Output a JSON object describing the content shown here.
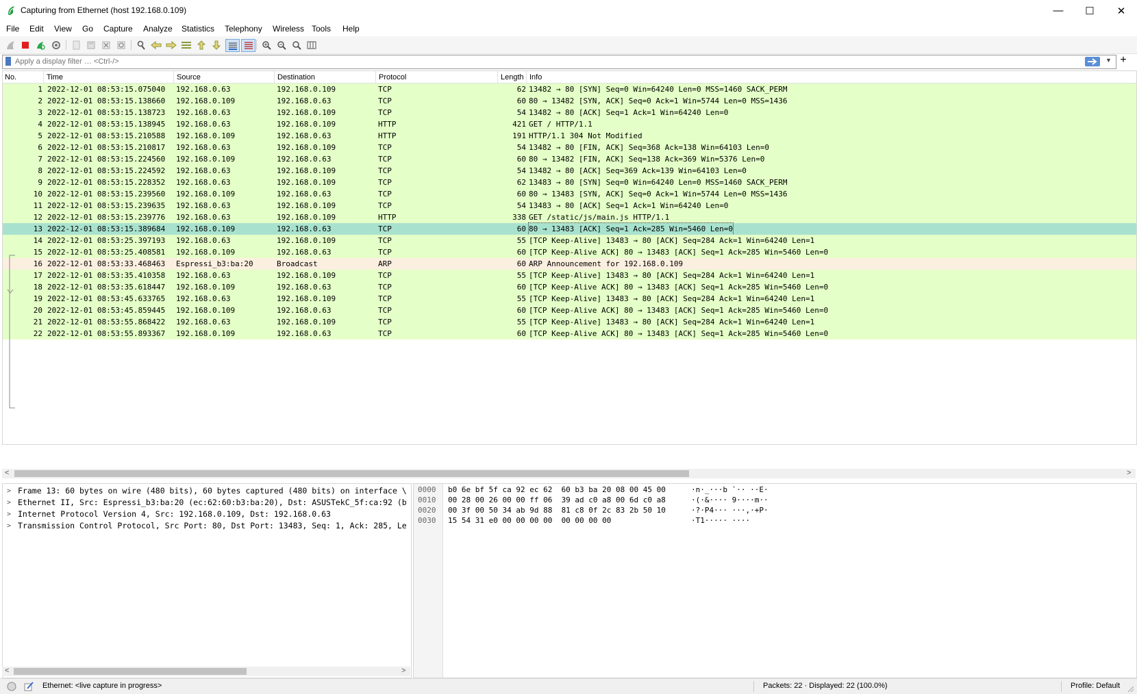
{
  "window": {
    "title": "Capturing from Ethernet (host 192.168.0.109)",
    "buttons": [
      "—",
      "☐",
      "✕"
    ]
  },
  "menu": [
    "File",
    "Edit",
    "View",
    "Go",
    "Capture",
    "Analyze",
    "Statistics",
    "Telephony",
    "Wireless",
    "Tools",
    "Help"
  ],
  "toolbar_icons": [
    "shark-fin-icon",
    "stop-icon",
    "restart-icon",
    "options-gear-icon",
    "open-file-icon",
    "save-file-icon",
    "close-file-icon",
    "reload-icon",
    "find-icon",
    "go-back-icon",
    "go-forward-icon",
    "go-to-packet-icon",
    "first-packet-icon",
    "last-packet-icon",
    "autoscroll-icon",
    "colorize-icon",
    "zoom-in-icon",
    "zoom-out-icon",
    "normal-size-icon",
    "resize-columns-icon"
  ],
  "filter": {
    "placeholder": "Apply a display filter … <Ctrl-/>",
    "value": ""
  },
  "columns": [
    "No.",
    "Time",
    "Source",
    "Destination",
    "Protocol",
    "Length",
    "Info"
  ],
  "colors": {
    "tcp": "#e4ffc7",
    "arp": "#fbefdf",
    "selected": "#a8e2cf"
  },
  "packets": [
    {
      "no": "1",
      "time": "2022-12-01 08:53:15.075040",
      "src": "192.168.0.63",
      "dst": "192.168.0.109",
      "proto": "TCP",
      "len": "62",
      "info": "13482 → 80 [SYN] Seq=0 Win=64240 Len=0 MSS=1460 SACK_PERM"
    },
    {
      "no": "2",
      "time": "2022-12-01 08:53:15.138660",
      "src": "192.168.0.109",
      "dst": "192.168.0.63",
      "proto": "TCP",
      "len": "60",
      "info": "80 → 13482 [SYN, ACK] Seq=0 Ack=1 Win=5744 Len=0 MSS=1436"
    },
    {
      "no": "3",
      "time": "2022-12-01 08:53:15.138723",
      "src": "192.168.0.63",
      "dst": "192.168.0.109",
      "proto": "TCP",
      "len": "54",
      "info": "13482 → 80 [ACK] Seq=1 Ack=1 Win=64240 Len=0"
    },
    {
      "no": "4",
      "time": "2022-12-01 08:53:15.138945",
      "src": "192.168.0.63",
      "dst": "192.168.0.109",
      "proto": "HTTP",
      "len": "421",
      "info": "GET / HTTP/1.1"
    },
    {
      "no": "5",
      "time": "2022-12-01 08:53:15.210588",
      "src": "192.168.0.109",
      "dst": "192.168.0.63",
      "proto": "HTTP",
      "len": "191",
      "info": "HTTP/1.1 304 Not Modified"
    },
    {
      "no": "6",
      "time": "2022-12-01 08:53:15.210817",
      "src": "192.168.0.63",
      "dst": "192.168.0.109",
      "proto": "TCP",
      "len": "54",
      "info": "13482 → 80 [FIN, ACK] Seq=368 Ack=138 Win=64103 Len=0"
    },
    {
      "no": "7",
      "time": "2022-12-01 08:53:15.224560",
      "src": "192.168.0.109",
      "dst": "192.168.0.63",
      "proto": "TCP",
      "len": "60",
      "info": "80 → 13482 [FIN, ACK] Seq=138 Ack=369 Win=5376 Len=0"
    },
    {
      "no": "8",
      "time": "2022-12-01 08:53:15.224592",
      "src": "192.168.0.63",
      "dst": "192.168.0.109",
      "proto": "TCP",
      "len": "54",
      "info": "13482 → 80 [ACK] Seq=369 Ack=139 Win=64103 Len=0"
    },
    {
      "no": "9",
      "time": "2022-12-01 08:53:15.228352",
      "src": "192.168.0.63",
      "dst": "192.168.0.109",
      "proto": "TCP",
      "len": "62",
      "info": "13483 → 80 [SYN] Seq=0 Win=64240 Len=0 MSS=1460 SACK_PERM"
    },
    {
      "no": "10",
      "time": "2022-12-01 08:53:15.239560",
      "src": "192.168.0.109",
      "dst": "192.168.0.63",
      "proto": "TCP",
      "len": "60",
      "info": "80 → 13483 [SYN, ACK] Seq=0 Ack=1 Win=5744 Len=0 MSS=1436"
    },
    {
      "no": "11",
      "time": "2022-12-01 08:53:15.239635",
      "src": "192.168.0.63",
      "dst": "192.168.0.109",
      "proto": "TCP",
      "len": "54",
      "info": "13483 → 80 [ACK] Seq=1 Ack=1 Win=64240 Len=0"
    },
    {
      "no": "12",
      "time": "2022-12-01 08:53:15.239776",
      "src": "192.168.0.63",
      "dst": "192.168.0.109",
      "proto": "HTTP",
      "len": "338",
      "info": "GET /static/js/main.js HTTP/1.1"
    },
    {
      "no": "13",
      "time": "2022-12-01 08:53:15.389684",
      "src": "192.168.0.109",
      "dst": "192.168.0.63",
      "proto": "TCP",
      "len": "60",
      "info": "80 → 13483 [ACK] Seq=1 Ack=285 Win=5460 Len=0",
      "selected": true
    },
    {
      "no": "14",
      "time": "2022-12-01 08:53:25.397193",
      "src": "192.168.0.63",
      "dst": "192.168.0.109",
      "proto": "TCP",
      "len": "55",
      "info": "[TCP Keep-Alive] 13483 → 80 [ACK] Seq=284 Ack=1 Win=64240 Len=1"
    },
    {
      "no": "15",
      "time": "2022-12-01 08:53:25.408581",
      "src": "192.168.0.109",
      "dst": "192.168.0.63",
      "proto": "TCP",
      "len": "60",
      "info": "[TCP Keep-Alive ACK] 80 → 13483 [ACK] Seq=1 Ack=285 Win=5460 Len=0"
    },
    {
      "no": "16",
      "time": "2022-12-01 08:53:33.468463",
      "src": "Espressi_b3:ba:20",
      "dst": "Broadcast",
      "proto": "ARP",
      "len": "60",
      "info": "ARP Announcement for 192.168.0.109"
    },
    {
      "no": "17",
      "time": "2022-12-01 08:53:35.410358",
      "src": "192.168.0.63",
      "dst": "192.168.0.109",
      "proto": "TCP",
      "len": "55",
      "info": "[TCP Keep-Alive] 13483 → 80 [ACK] Seq=284 Ack=1 Win=64240 Len=1"
    },
    {
      "no": "18",
      "time": "2022-12-01 08:53:35.618447",
      "src": "192.168.0.109",
      "dst": "192.168.0.63",
      "proto": "TCP",
      "len": "60",
      "info": "[TCP Keep-Alive ACK] 80 → 13483 [ACK] Seq=1 Ack=285 Win=5460 Len=0"
    },
    {
      "no": "19",
      "time": "2022-12-01 08:53:45.633765",
      "src": "192.168.0.63",
      "dst": "192.168.0.109",
      "proto": "TCP",
      "len": "55",
      "info": "[TCP Keep-Alive] 13483 → 80 [ACK] Seq=284 Ack=1 Win=64240 Len=1"
    },
    {
      "no": "20",
      "time": "2022-12-01 08:53:45.859445",
      "src": "192.168.0.109",
      "dst": "192.168.0.63",
      "proto": "TCP",
      "len": "60",
      "info": "[TCP Keep-Alive ACK] 80 → 13483 [ACK] Seq=1 Ack=285 Win=5460 Len=0"
    },
    {
      "no": "21",
      "time": "2022-12-01 08:53:55.868422",
      "src": "192.168.0.63",
      "dst": "192.168.0.109",
      "proto": "TCP",
      "len": "55",
      "info": "[TCP Keep-Alive] 13483 → 80 [ACK] Seq=284 Ack=1 Win=64240 Len=1"
    },
    {
      "no": "22",
      "time": "2022-12-01 08:53:55.893367",
      "src": "192.168.0.109",
      "dst": "192.168.0.63",
      "proto": "TCP",
      "len": "60",
      "info": "[TCP Keep-Alive ACK] 80 → 13483 [ACK] Seq=1 Ack=285 Win=5460 Len=0"
    }
  ],
  "details": [
    "Frame 13: 60 bytes on wire (480 bits), 60 bytes captured (480 bits) on interface \\",
    "Ethernet II, Src: Espressi_b3:ba:20 (ec:62:60:b3:ba:20), Dst: ASUSTekC_5f:ca:92 (b",
    "Internet Protocol Version 4, Src: 192.168.0.109, Dst: 192.168.0.63",
    "Transmission Control Protocol, Src Port: 80, Dst Port: 13483, Seq: 1, Ack: 285, Le"
  ],
  "hex": [
    {
      "off": "0000",
      "hex": "b0 6e bf 5f ca 92 ec 62  60 b3 ba 20 08 00 45 00",
      "ascii": "·n·_···b `·· ··E·"
    },
    {
      "off": "0010",
      "hex": "00 28 00 26 00 00 ff 06  39 ad c0 a8 00 6d c0 a8",
      "ascii": "·(·&···· 9····m··"
    },
    {
      "off": "0020",
      "hex": "00 3f 00 50 34 ab 9d 88  81 c8 0f 2c 83 2b 50 10",
      "ascii": "·?·P4··· ···,·+P·"
    },
    {
      "off": "0030",
      "hex": "15 54 31 e0 00 00 00 00  00 00 00 00",
      "ascii": "·T1····· ····"
    }
  ],
  "status": {
    "interface": "Ethernet: <live capture in progress>",
    "packets": "Packets: 22 · Displayed: 22 (100.0%)",
    "profile": "Profile: Default"
  }
}
